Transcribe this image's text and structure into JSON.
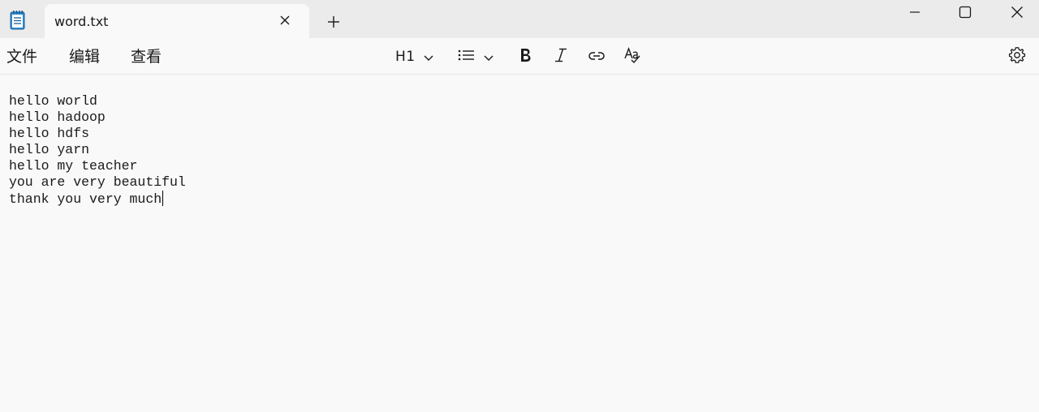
{
  "window": {
    "tab_title": "word.txt",
    "icons": {
      "app": "notepad-icon",
      "close_tab": "close-icon",
      "new_tab": "plus-icon",
      "minimize": "minimize-icon",
      "maximize": "maximize-icon",
      "close": "close-icon"
    }
  },
  "menu": {
    "file": "文件",
    "edit": "编辑",
    "view": "查看"
  },
  "toolbar": {
    "heading_label": "H1",
    "icons": [
      "chevron-down-icon",
      "bulleted-list-icon",
      "bold-icon",
      "italic-icon",
      "link-icon",
      "spellcheck-icon",
      "settings-icon"
    ]
  },
  "document": {
    "lines": [
      "hello world",
      "hello hadoop",
      "hello hdfs",
      "hello yarn",
      "hello my teacher",
      "you are very beautiful",
      "thank you very much"
    ]
  },
  "colors": {
    "titlebar_bg": "#ebebeb",
    "editor_bg": "#f9f9f9",
    "app_icon_blue": "#2f8fd8"
  }
}
